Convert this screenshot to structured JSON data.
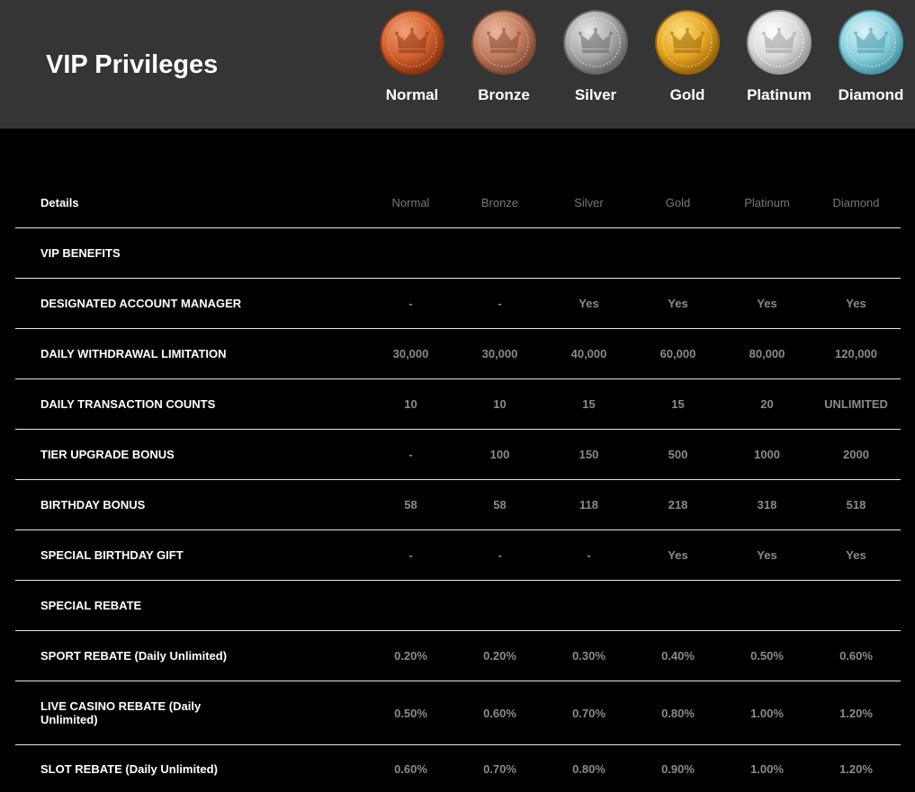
{
  "header": {
    "title": "VIP Privileges",
    "tiers": [
      {
        "name": "Normal",
        "icon": "crown-medal-icon",
        "colors": [
          "#f3a37d",
          "#d2622f",
          "#8c3512"
        ]
      },
      {
        "name": "Bronze",
        "icon": "crown-medal-icon",
        "colors": [
          "#eab9a2",
          "#c27d5e",
          "#7f4a33"
        ]
      },
      {
        "name": "Silver",
        "icon": "crown-medal-icon",
        "colors": [
          "#e8e8e8",
          "#a9a9a9",
          "#666666"
        ]
      },
      {
        "name": "Gold",
        "icon": "crown-medal-icon",
        "colors": [
          "#fbe07d",
          "#e6a723",
          "#99640b"
        ]
      },
      {
        "name": "Platinum",
        "icon": "crown-medal-icon",
        "colors": [
          "#ffffff",
          "#dadada",
          "#9c9c9c"
        ]
      },
      {
        "name": "Diamond",
        "icon": "crown-medal-icon",
        "colors": [
          "#d7f4f9",
          "#8fd3df",
          "#4a97a6"
        ]
      }
    ]
  },
  "table": {
    "details_label": "Details",
    "columns": [
      "Normal",
      "Bronze",
      "Silver",
      "Gold",
      "Platinum",
      "Diamond"
    ],
    "rows": [
      {
        "label": "VIP BENEFITS",
        "values": [
          "",
          "",
          "",
          "",
          "",
          ""
        ]
      },
      {
        "label": "DESIGNATED ACCOUNT MANAGER",
        "values": [
          "-",
          "-",
          "Yes",
          "Yes",
          "Yes",
          "Yes"
        ]
      },
      {
        "label": "DAILY WITHDRAWAL LIMITATION",
        "values": [
          "30,000",
          "30,000",
          "40,000",
          "60,000",
          "80,000",
          "120,000"
        ]
      },
      {
        "label": "DAILY TRANSACTION COUNTS",
        "values": [
          "10",
          "10",
          "15",
          "15",
          "20",
          "UNLIMITED"
        ]
      },
      {
        "label": "TIER UPGRADE BONUS",
        "values": [
          "-",
          "100",
          "150",
          "500",
          "1000",
          "2000"
        ]
      },
      {
        "label": "BIRTHDAY BONUS",
        "values": [
          "58",
          "58",
          "118",
          "218",
          "318",
          "518"
        ]
      },
      {
        "label": "SPECIAL BIRTHDAY GIFT",
        "values": [
          "-",
          "-",
          "-",
          "Yes",
          "Yes",
          "Yes"
        ]
      },
      {
        "label": "SPECIAL REBATE",
        "values": [
          "",
          "",
          "",
          "",
          "",
          ""
        ]
      },
      {
        "label": "SPORT REBATE  (Daily Unlimited)",
        "values": [
          "0.20%",
          "0.20%",
          "0.30%",
          "0.40%",
          "0.50%",
          "0.60%"
        ]
      },
      {
        "label": "LIVE CASINO REBATE  (Daily Unlimited)",
        "values": [
          "0.50%",
          "0.60%",
          "0.70%",
          "0.80%",
          "1.00%",
          "1.20%"
        ]
      },
      {
        "label": "SLOT REBATE  (Daily Unlimited)",
        "values": [
          "0.60%",
          "0.70%",
          "0.80%",
          "0.90%",
          "1.00%",
          "1.20%"
        ]
      }
    ]
  }
}
